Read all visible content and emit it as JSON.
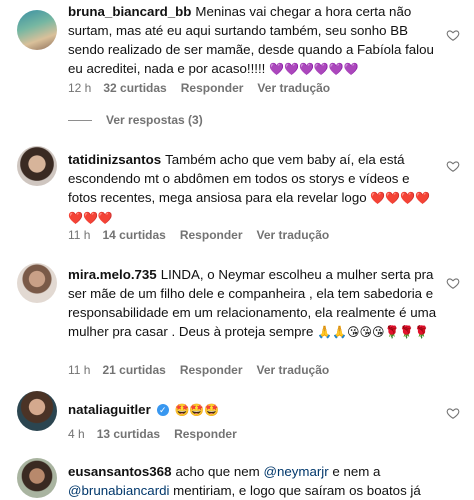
{
  "comments": [
    {
      "username": "bruna_biancard_bb",
      "text": "Meninas vai chegar a hora certa não surtam, mas até eu aqui surtando também, seu sonho BB sendo realizado de ser mamãe, desde quando a Fabíola falou eu acreditei, nada e por acaso!!!!!",
      "emojis": "💜💜💜💜💜💜",
      "time": "12 h",
      "likes": "32 curtidas",
      "reply": "Responder",
      "translate": "Ver tradução",
      "view_replies": "Ver respostas (3)"
    },
    {
      "username": "tatidinizsantos",
      "text": "Também acho que vem baby aí, ela está escondendo mt o abdômen em todos os storys e vídeos e fotos recentes, mega ansiosa para ela revelar logo",
      "emojis": "❤️❤️❤️❤️❤️❤️❤️",
      "time": "11 h",
      "likes": "14 curtidas",
      "reply": "Responder",
      "translate": "Ver tradução"
    },
    {
      "username": "mira.melo.735",
      "text": "LINDA, o Neymar escolheu a mulher serta pra ser mãe de um filho dele e companheira , ela tem sabedoria e responsabilidade em um relacionamento, ela realmente é uma mulher pra casar . Deus à proteja sempre",
      "emojis": "🙏🙏😘😘😘🌹🌹🌹",
      "time": "11 h",
      "likes": "21 curtidas",
      "reply": "Responder",
      "translate": "Ver tradução"
    },
    {
      "username": "nataliaguitler",
      "emojis": "🤩🤩🤩",
      "time": "4 h",
      "likes": "13 curtidas",
      "reply": "Responder"
    },
    {
      "username": "eusansantos368",
      "text_a": "acho que nem",
      "mention1": "@neymarjr",
      "text_b": "e nem a",
      "mention2": "@brunabiancardi",
      "text_c": "mentiriam, e logo que saíram os boatos já"
    }
  ],
  "colors": {
    "meta": "#737373",
    "mention": "#00376b",
    "verified": "#3897f0"
  }
}
